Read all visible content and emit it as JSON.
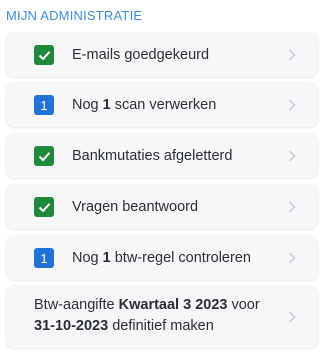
{
  "section": {
    "title": "MIJN ADMINISTRATIE"
  },
  "items": [
    {
      "badge": "",
      "badge_type": "check",
      "text_pre": "E-mails goedgekeurd",
      "text_bold": "",
      "text_post": ""
    },
    {
      "badge": "1",
      "badge_type": "count",
      "text_pre": "Nog ",
      "text_bold": "1",
      "text_post": " scan verwerken"
    },
    {
      "badge": "",
      "badge_type": "check",
      "text_pre": "Bankmutaties afgeletterd",
      "text_bold": "",
      "text_post": ""
    },
    {
      "badge": "",
      "badge_type": "check",
      "text_pre": "Vragen beantwoord",
      "text_bold": "",
      "text_post": ""
    },
    {
      "badge": "1",
      "badge_type": "count",
      "text_pre": "Nog ",
      "text_bold": "1",
      "text_post": " btw-regel controleren"
    }
  ],
  "vat": {
    "pre": "Btw-aangifte ",
    "bold1": "Kwartaal 3 2023",
    "mid": " voor",
    "bold2": "31-10-2023",
    "post": " definitief maken"
  },
  "colors": {
    "accent": "#3b8fd9",
    "check_badge": "#1f8a3b",
    "count_badge": "#1f73d4",
    "card_bg": "#f6f7f9"
  },
  "icons": {
    "done": "check-icon",
    "chevron": "chevron-right-icon"
  }
}
